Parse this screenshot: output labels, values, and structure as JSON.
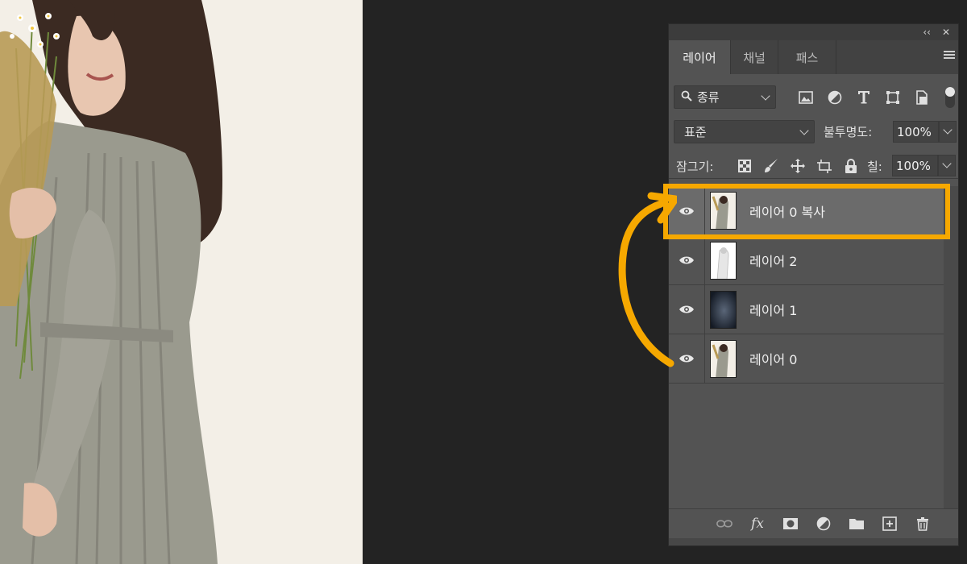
{
  "panel": {
    "top_buttons": {
      "collapse": "‹‹",
      "close": "✕"
    },
    "tabs": [
      {
        "label": "레이어",
        "active": true
      },
      {
        "label": "채널",
        "active": false
      },
      {
        "label": "패스",
        "active": false
      }
    ],
    "filter": {
      "kind_label": "종류",
      "icons": [
        "image-filter-icon",
        "adjustment-filter-icon",
        "type-filter-icon",
        "shape-filter-icon",
        "smart-object-filter-icon"
      ]
    },
    "blend": {
      "mode": "표준",
      "opacity_label": "불투명도:",
      "opacity_value": "100%"
    },
    "lock": {
      "label": "잠그기:",
      "fill_label": "칠:",
      "fill_value": "100%"
    },
    "layers": [
      {
        "name": "레이어 0 복사",
        "selected": true,
        "thumb": "photo"
      },
      {
        "name": "레이어 2",
        "selected": false,
        "thumb": "white-figure"
      },
      {
        "name": "레이어 1",
        "selected": false,
        "thumb": "dark-gradient"
      },
      {
        "name": "레이어 0",
        "selected": false,
        "thumb": "photo"
      }
    ],
    "bottom_icons": [
      "link-icon",
      "fx-icon",
      "mask-icon",
      "adjustment-icon",
      "folder-icon",
      "new-layer-icon",
      "trash-icon"
    ],
    "fx_label": "fx"
  },
  "colors": {
    "highlight": "#f6a800",
    "panel_bg": "#535353",
    "canvas_bg": "#232323"
  }
}
